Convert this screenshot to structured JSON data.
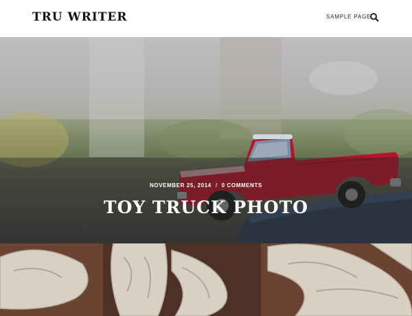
{
  "site": {
    "title": "TRU WRITER"
  },
  "nav": {
    "sample_page": "SAMPLE PAGE",
    "search_icon": "search-icon"
  },
  "post": {
    "date": "NOVEMBER 25, 2014",
    "separator": "/",
    "comments": "0 COMMENTS",
    "title": "TOY TRUCK PHOTO"
  },
  "colors": {
    "header_bg": "#ffffff",
    "title_text": "#111111",
    "overlay": "rgba(40,40,40,0.42)",
    "truck_red": "#b5152a"
  }
}
